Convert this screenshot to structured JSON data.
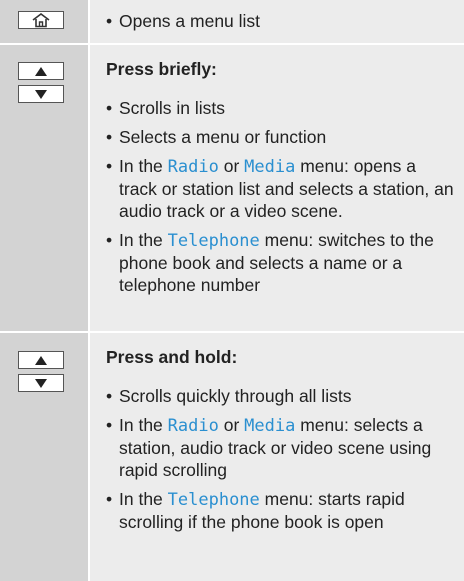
{
  "rows": [
    {
      "icons": [
        "home-icon"
      ],
      "bullets": [
        {
          "pre": "Opens a menu list"
        }
      ]
    },
    {
      "icons": [
        "arrow-up-icon",
        "arrow-down-icon"
      ],
      "heading": "Press briefly:",
      "bullets": [
        {
          "pre": "Scrolls in lists"
        },
        {
          "pre": "Selects a menu or function"
        },
        {
          "pre": "In the ",
          "kw1": "Radio",
          "mid": " or ",
          "kw2": "Media",
          "post": " menu: opens a track or station list and selects a station, an audio track or a video scene."
        },
        {
          "pre": "In the ",
          "kw1": "Telephone",
          "post": " menu: switches to the phone book and selects a name or a telephone number"
        }
      ]
    },
    {
      "icons": [
        "arrow-up-icon",
        "arrow-down-icon"
      ],
      "heading": "Press and hold:",
      "bullets": [
        {
          "pre": "Scrolls quickly through all lists"
        },
        {
          "pre": "In the ",
          "kw1": "Radio",
          "mid": " or ",
          "kw2": "Media",
          "post": " menu: selects a station, audio track or video scene using rapid scrolling"
        },
        {
          "pre": "In the ",
          "kw1": "Telephone",
          "post": " menu: starts rapid scrolling if the phone book is open"
        }
      ]
    }
  ],
  "colors": {
    "keyword": "#2a8fd0",
    "icon_column": "#d3d3d3",
    "text_column": "#ececec"
  }
}
